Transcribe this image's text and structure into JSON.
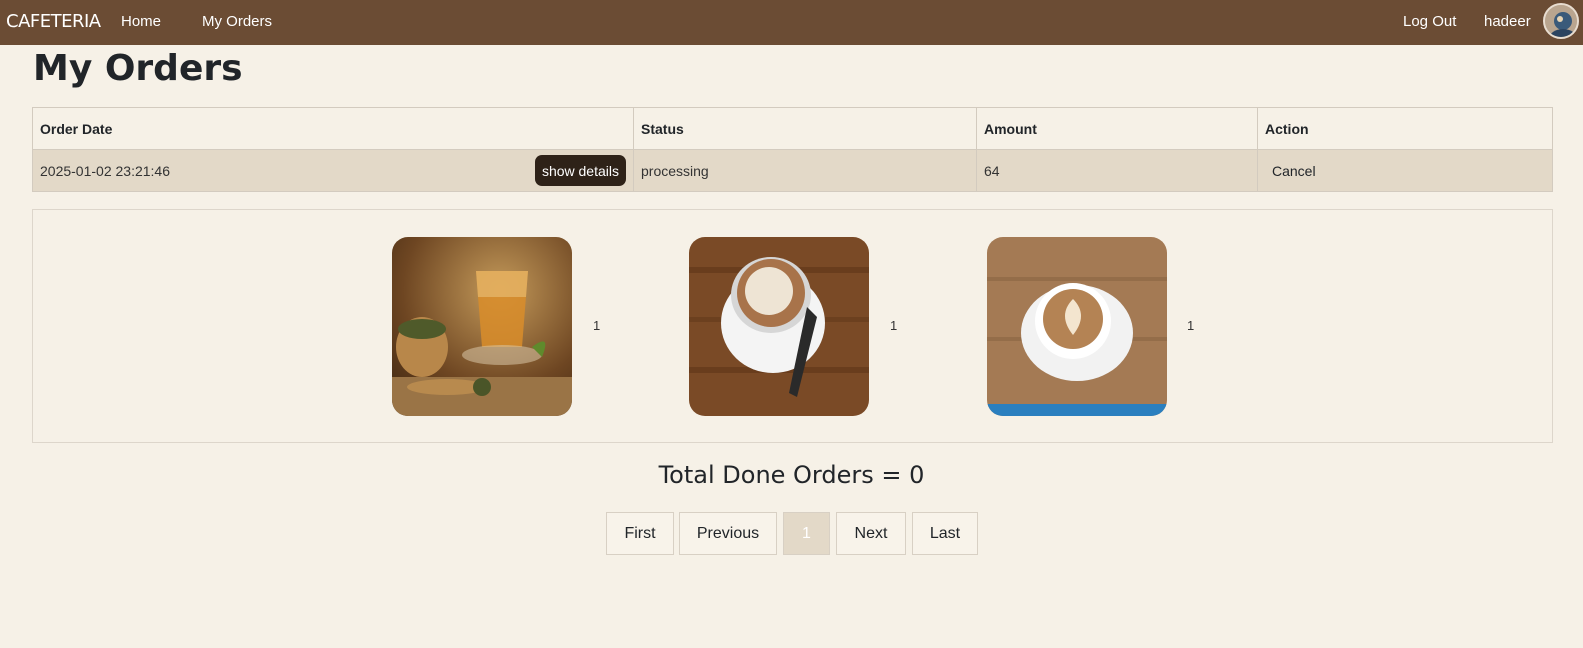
{
  "navbar": {
    "brand": "CAFETERIA",
    "home": "Home",
    "my_orders": "My Orders",
    "logout": "Log Out",
    "username": "hadeer"
  },
  "page_title": "My Orders",
  "table": {
    "headers": [
      "Order Date",
      "Status",
      "Amount",
      "Action"
    ],
    "rows": [
      {
        "order_date": "2025-01-02 23:21:46",
        "details_label": "show details",
        "status": "processing",
        "amount": "64",
        "action": "Cancel"
      }
    ]
  },
  "order_items": [
    {
      "image": "tea",
      "quantity": "1"
    },
    {
      "image": "cappuccino",
      "quantity": "1"
    },
    {
      "image": "latte",
      "quantity": "1"
    }
  ],
  "total_done": "Total Done Orders = 0",
  "pagination": {
    "first": "First",
    "previous": "Previous",
    "current": "1",
    "next": "Next",
    "last": "Last"
  },
  "colors": {
    "navbar": "#6b4c34",
    "background": "#f6f1e7",
    "row_background": "#e3d9c8",
    "details_button": "#2e2218"
  }
}
